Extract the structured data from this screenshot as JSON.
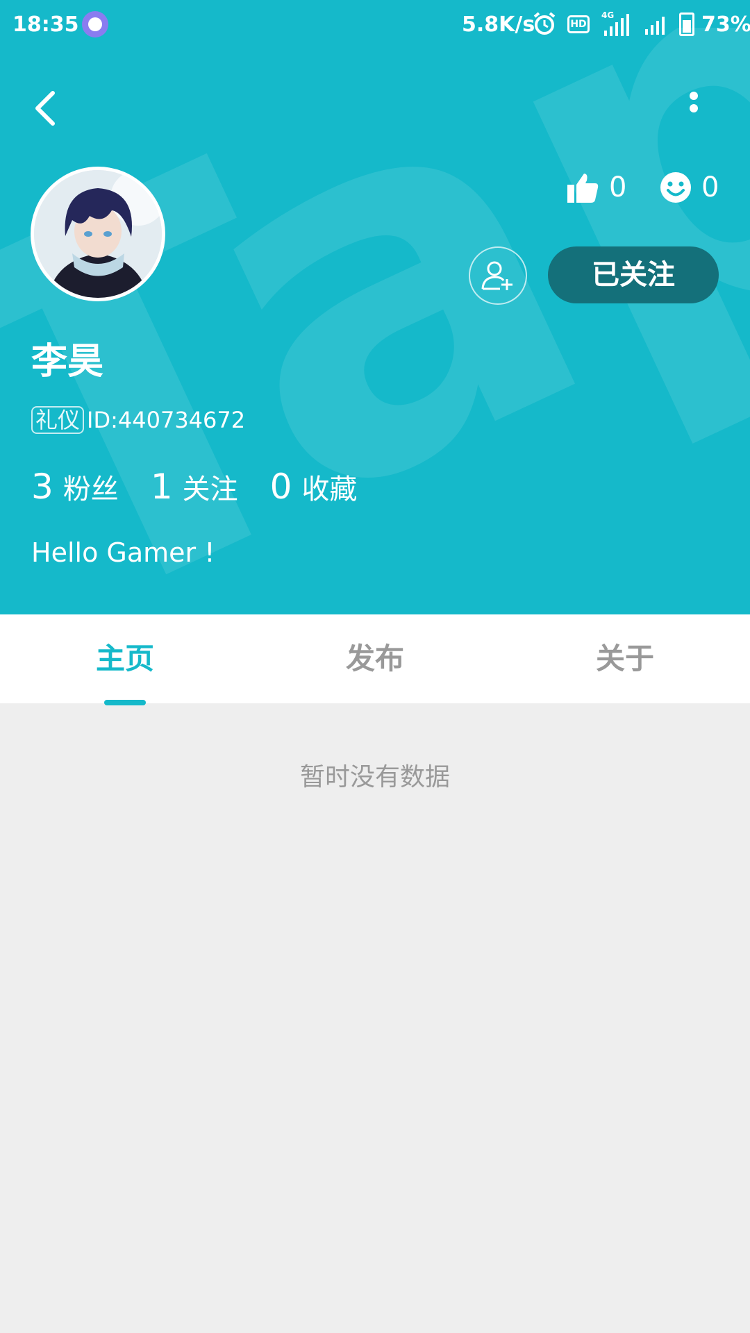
{
  "status_bar": {
    "time": "18:35",
    "net_speed": "5.8K/s",
    "hd_label": "HD",
    "network_type": "4G",
    "battery": "73%"
  },
  "header": {
    "background_color": "#15b9ca",
    "watermark_text": "TapTap"
  },
  "profile": {
    "name": "李昊",
    "badge": "礼仪",
    "id_text": "ID:440734672",
    "likes": "0",
    "smiles": "0",
    "follow_button": "已关注",
    "counts": [
      {
        "value": "3",
        "label": "粉丝"
      },
      {
        "value": "1",
        "label": "关注"
      },
      {
        "value": "0",
        "label": "收藏"
      }
    ],
    "bio": "Hello Gamer !"
  },
  "tabs": [
    {
      "label": "主页",
      "active": true
    },
    {
      "label": "发布",
      "active": false
    },
    {
      "label": "关于",
      "active": false
    }
  ],
  "content": {
    "empty_message": "暂时没有数据"
  },
  "icons": [
    "back-arrow-icon",
    "more-vertical-icon",
    "thumbs-up-icon",
    "smiley-icon",
    "add-friend-icon",
    "alarm-icon",
    "signal-icon",
    "battery-icon"
  ]
}
